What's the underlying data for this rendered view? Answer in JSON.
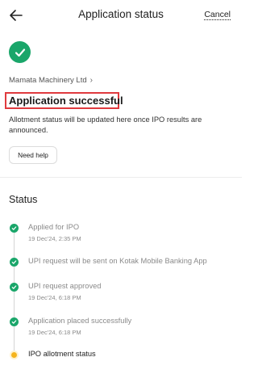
{
  "header": {
    "title": "Application status",
    "cancel_label": "Cancel"
  },
  "company": {
    "name": "Mamata Machinery Ltd",
    "chevron": "›"
  },
  "status": {
    "title": "Application successful",
    "description": "Allotment status will be updated here once IPO results are announced.",
    "help_label": "Need help",
    "color": "#1aa66a"
  },
  "timeline": {
    "section_title": "Status",
    "steps": [
      {
        "label": "Applied for IPO",
        "time": "19 Dec'24, 2:35 PM",
        "state": "done"
      },
      {
        "label": "UPI request will be sent on Kotak Mobile Banking App",
        "time": "",
        "state": "done"
      },
      {
        "label": "UPI request approved",
        "time": "19 Dec'24, 6:18 PM",
        "state": "done"
      },
      {
        "label": "Application placed successfully",
        "time": "19 Dec'24, 6:18 PM",
        "state": "done"
      },
      {
        "label": "IPO allotment status",
        "time": "",
        "state": "pending"
      }
    ]
  },
  "colors": {
    "success": "#1aa66a",
    "pending": "#f5b41c",
    "highlight": "#e03a3e"
  },
  "icons": {
    "back": "arrow-left-icon",
    "success": "check-circle-icon",
    "step_done": "check-small-icon"
  }
}
